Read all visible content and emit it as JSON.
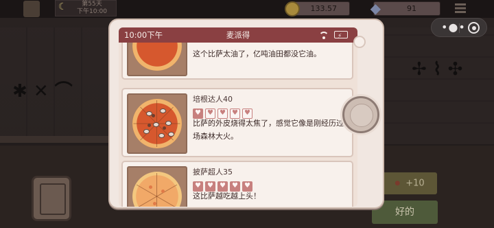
{
  "topbar": {
    "day_label": "第55天",
    "time_label": "下午10:00",
    "coins": "133.57",
    "gems": "91"
  },
  "tablet": {
    "status_time": "10:00下午",
    "app_title": "麦派得"
  },
  "reviews": [
    {
      "reviewer": "",
      "rating": 0,
      "comment": "这个比萨太油了，亿吨油田都没它油。",
      "pizza": "toppings"
    },
    {
      "reviewer": "培根达人40",
      "rating": 1,
      "comment": "比萨的外皮烧得太焦了，感觉它像是刚经历过一场森林大火。",
      "pizza": "toppings"
    },
    {
      "reviewer": "披萨超人35",
      "rating": 5,
      "comment": "这比萨越吃越上头！",
      "pizza": "plain"
    }
  ],
  "buttons": {
    "reward_label": "+10",
    "ok_label": "好的"
  },
  "icons": {
    "moon": "moon-icon",
    "coin": "coin-icon",
    "gem": "diamond-icon",
    "menu": "menu-icon",
    "wifi": "wifi-icon",
    "battery": "battery-charging-icon",
    "heart": "heart-icon"
  },
  "colors": {
    "status_bar": "#8a4042",
    "heart_on": "#c7807e",
    "ok_button": "#4e5a3a"
  }
}
